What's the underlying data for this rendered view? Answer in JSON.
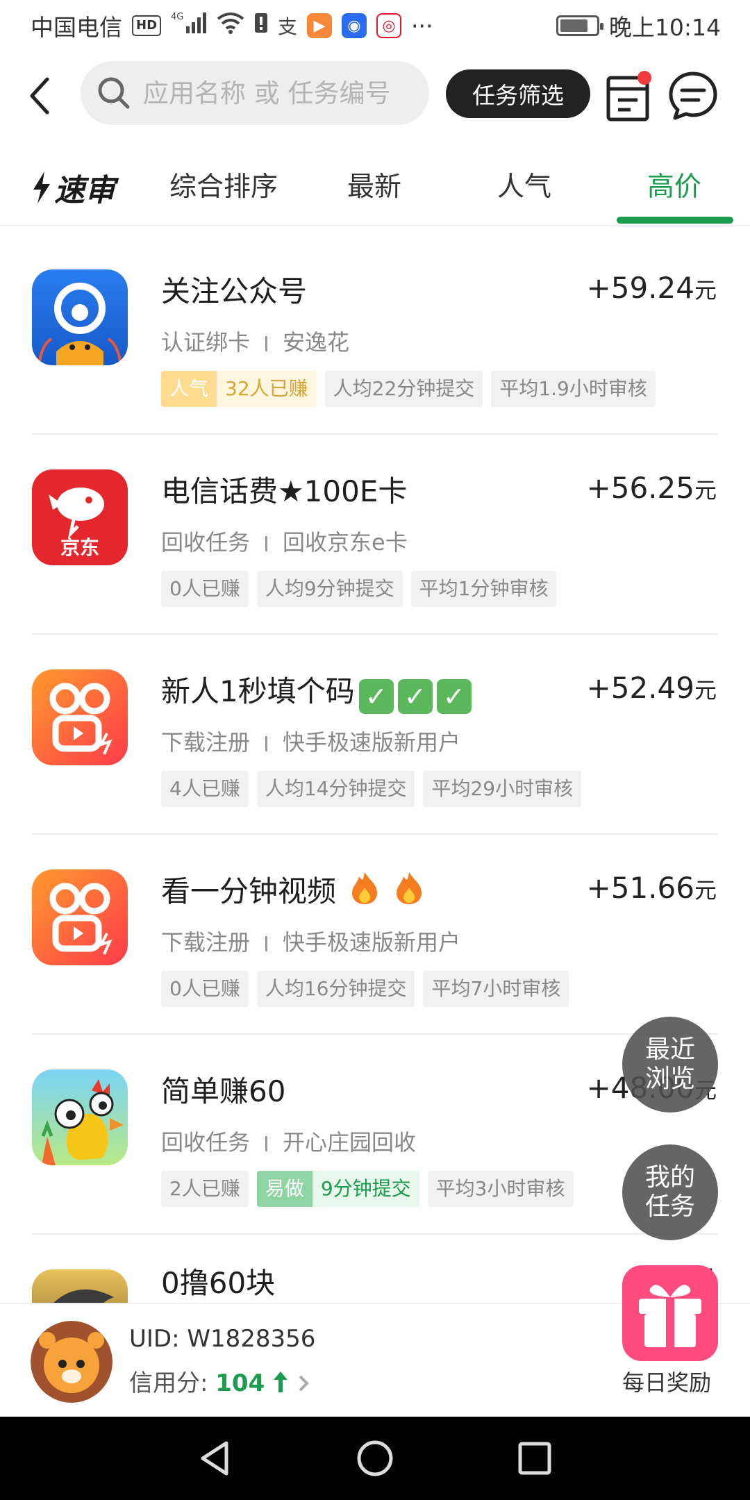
{
  "status_bar": {
    "carrier": "中国电信",
    "hd": "HD",
    "network": "4G",
    "apps": [
      {
        "icon": "alipay-icon",
        "glyph": "支"
      },
      {
        "icon": "play-icon",
        "glyph": "▶",
        "color": "#f7883a"
      },
      {
        "icon": "bulb-icon",
        "glyph": "◉",
        "color": "#2a6bf2"
      },
      {
        "icon": "weibo-icon",
        "glyph": "◎",
        "color": "#e6162d"
      }
    ],
    "more": "···",
    "time": "晚上10:14"
  },
  "header": {
    "search_placeholder": "应用名称 或 任务编号",
    "filter_label": "任务筛选"
  },
  "tabs": {
    "logo": "速审",
    "items": [
      "综合排序",
      "最新",
      "人气",
      "高价"
    ],
    "active_index": 3,
    "accent": "#1c9a4d"
  },
  "tasks": [
    {
      "title": "关注公众号",
      "category": "认证绑卡",
      "app": "安逸花",
      "price": "+59.24",
      "unit": "元",
      "hot_tag": {
        "a": "人气",
        "b": "32人已赚"
      },
      "tags": [
        "人均22分钟提交",
        "平均1.9小时审核"
      ],
      "icon": "anyihua-icon"
    },
    {
      "title": "电信话费★100E卡",
      "category": "回收任务",
      "app": "回收京东e卡",
      "price": "+56.25",
      "unit": "元",
      "tags": [
        "0人已赚",
        "人均9分钟提交",
        "平均1分钟审核"
      ],
      "icon": "jd-icon",
      "icon_text": "京东"
    },
    {
      "title": "新人1秒填个码",
      "category": "下载注册",
      "app": "快手极速版新用户",
      "price": "+52.49",
      "unit": "元",
      "tags": [
        "4人已赚",
        "人均14分钟提交",
        "平均29小时审核"
      ],
      "icon": "kuaishou-icon"
    },
    {
      "title": "看一分钟视频",
      "category": "下载注册",
      "app": "快手极速版新用户",
      "price": "+51.66",
      "unit": "元",
      "tags": [
        "0人已赚",
        "人均16分钟提交",
        "平均7小时审核"
      ],
      "icon": "kuaishou-icon"
    },
    {
      "title": "简单赚60",
      "category": "回收任务",
      "app": "开心庄园回收",
      "price": "+48.00",
      "unit": "元",
      "tags_before": [
        "2人已赚"
      ],
      "easy_tag": {
        "a": "易做",
        "b": "9分钟提交"
      },
      "tags": [
        "平均3小时审核"
      ],
      "icon": "happy-farm-icon"
    },
    {
      "title": "0撸60块",
      "price": "+4",
      "icon": "dragon-game-icon"
    }
  ],
  "floating": {
    "recent": "最近\n浏览",
    "my_tasks": "我的\n任务",
    "gift_label": "每日奖励"
  },
  "user": {
    "uid": "UID: W1828356",
    "credit_label": "信用分: ",
    "credit_value": "104"
  }
}
